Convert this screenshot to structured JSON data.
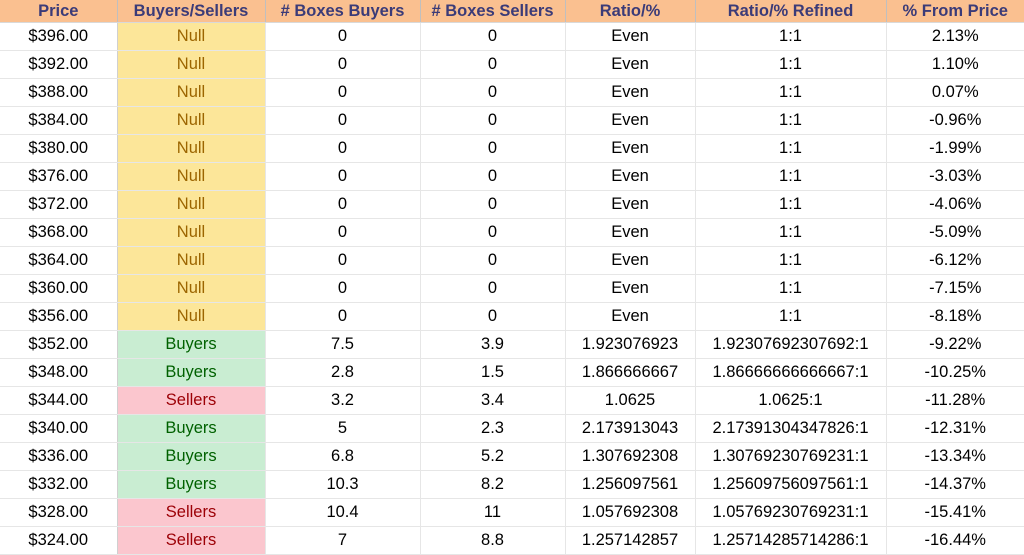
{
  "table": {
    "name": "price-level-order-book-table",
    "columns": [
      {
        "key": "price",
        "label": "Price"
      },
      {
        "key": "side",
        "label": "Buyers/Sellers"
      },
      {
        "key": "boxes_buyers",
        "label": "# Boxes Buyers"
      },
      {
        "key": "boxes_sellers",
        "label": "# Boxes Sellers"
      },
      {
        "key": "ratio_pct",
        "label": "Ratio/%"
      },
      {
        "key": "ratio_refined",
        "label": "Ratio/% Refined"
      },
      {
        "key": "pct_from_price",
        "label": "% From Price"
      }
    ],
    "colors": {
      "header_bg": "#fac090",
      "header_text": "#3b3b78",
      "null_bg": "#fce699",
      "null_text": "#9c6500",
      "buyers_bg": "#c9edd2",
      "buyers_text": "#006100",
      "sellers_bg": "#fbc6ce",
      "sellers_text": "#9c0006",
      "grid_line": "#e6e6e6"
    },
    "rows": [
      {
        "price": "$396.00",
        "side": "Null",
        "side_state": "null",
        "boxes_buyers": "0",
        "boxes_sellers": "0",
        "ratio_pct": "Even",
        "ratio_refined": "1:1",
        "pct_from_price": "2.13%"
      },
      {
        "price": "$392.00",
        "side": "Null",
        "side_state": "null",
        "boxes_buyers": "0",
        "boxes_sellers": "0",
        "ratio_pct": "Even",
        "ratio_refined": "1:1",
        "pct_from_price": "1.10%"
      },
      {
        "price": "$388.00",
        "side": "Null",
        "side_state": "null",
        "boxes_buyers": "0",
        "boxes_sellers": "0",
        "ratio_pct": "Even",
        "ratio_refined": "1:1",
        "pct_from_price": "0.07%"
      },
      {
        "price": "$384.00",
        "side": "Null",
        "side_state": "null",
        "boxes_buyers": "0",
        "boxes_sellers": "0",
        "ratio_pct": "Even",
        "ratio_refined": "1:1",
        "pct_from_price": "-0.96%"
      },
      {
        "price": "$380.00",
        "side": "Null",
        "side_state": "null",
        "boxes_buyers": "0",
        "boxes_sellers": "0",
        "ratio_pct": "Even",
        "ratio_refined": "1:1",
        "pct_from_price": "-1.99%"
      },
      {
        "price": "$376.00",
        "side": "Null",
        "side_state": "null",
        "boxes_buyers": "0",
        "boxes_sellers": "0",
        "ratio_pct": "Even",
        "ratio_refined": "1:1",
        "pct_from_price": "-3.03%"
      },
      {
        "price": "$372.00",
        "side": "Null",
        "side_state": "null",
        "boxes_buyers": "0",
        "boxes_sellers": "0",
        "ratio_pct": "Even",
        "ratio_refined": "1:1",
        "pct_from_price": "-4.06%"
      },
      {
        "price": "$368.00",
        "side": "Null",
        "side_state": "null",
        "boxes_buyers": "0",
        "boxes_sellers": "0",
        "ratio_pct": "Even",
        "ratio_refined": "1:1",
        "pct_from_price": "-5.09%"
      },
      {
        "price": "$364.00",
        "side": "Null",
        "side_state": "null",
        "boxes_buyers": "0",
        "boxes_sellers": "0",
        "ratio_pct": "Even",
        "ratio_refined": "1:1",
        "pct_from_price": "-6.12%"
      },
      {
        "price": "$360.00",
        "side": "Null",
        "side_state": "null",
        "boxes_buyers": "0",
        "boxes_sellers": "0",
        "ratio_pct": "Even",
        "ratio_refined": "1:1",
        "pct_from_price": "-7.15%"
      },
      {
        "price": "$356.00",
        "side": "Null",
        "side_state": "null",
        "boxes_buyers": "0",
        "boxes_sellers": "0",
        "ratio_pct": "Even",
        "ratio_refined": "1:1",
        "pct_from_price": "-8.18%"
      },
      {
        "price": "$352.00",
        "side": "Buyers",
        "side_state": "buyers",
        "boxes_buyers": "7.5",
        "boxes_sellers": "3.9",
        "ratio_pct": "1.923076923",
        "ratio_refined": "1.92307692307692:1",
        "pct_from_price": "-9.22%"
      },
      {
        "price": "$348.00",
        "side": "Buyers",
        "side_state": "buyers",
        "boxes_buyers": "2.8",
        "boxes_sellers": "1.5",
        "ratio_pct": "1.866666667",
        "ratio_refined": "1.86666666666667:1",
        "pct_from_price": "-10.25%"
      },
      {
        "price": "$344.00",
        "side": "Sellers",
        "side_state": "sellers",
        "boxes_buyers": "3.2",
        "boxes_sellers": "3.4",
        "ratio_pct": "1.0625",
        "ratio_refined": "1.0625:1",
        "pct_from_price": "-11.28%"
      },
      {
        "price": "$340.00",
        "side": "Buyers",
        "side_state": "buyers",
        "boxes_buyers": "5",
        "boxes_sellers": "2.3",
        "ratio_pct": "2.173913043",
        "ratio_refined": "2.17391304347826:1",
        "pct_from_price": "-12.31%"
      },
      {
        "price": "$336.00",
        "side": "Buyers",
        "side_state": "buyers",
        "boxes_buyers": "6.8",
        "boxes_sellers": "5.2",
        "ratio_pct": "1.307692308",
        "ratio_refined": "1.30769230769231:1",
        "pct_from_price": "-13.34%"
      },
      {
        "price": "$332.00",
        "side": "Buyers",
        "side_state": "buyers",
        "boxes_buyers": "10.3",
        "boxes_sellers": "8.2",
        "ratio_pct": "1.256097561",
        "ratio_refined": "1.25609756097561:1",
        "pct_from_price": "-14.37%"
      },
      {
        "price": "$328.00",
        "side": "Sellers",
        "side_state": "sellers",
        "boxes_buyers": "10.4",
        "boxes_sellers": "11",
        "ratio_pct": "1.057692308",
        "ratio_refined": "1.05769230769231:1",
        "pct_from_price": "-15.41%"
      },
      {
        "price": "$324.00",
        "side": "Sellers",
        "side_state": "sellers",
        "boxes_buyers": "7",
        "boxes_sellers": "8.8",
        "ratio_pct": "1.257142857",
        "ratio_refined": "1.25714285714286:1",
        "pct_from_price": "-16.44%"
      }
    ]
  }
}
